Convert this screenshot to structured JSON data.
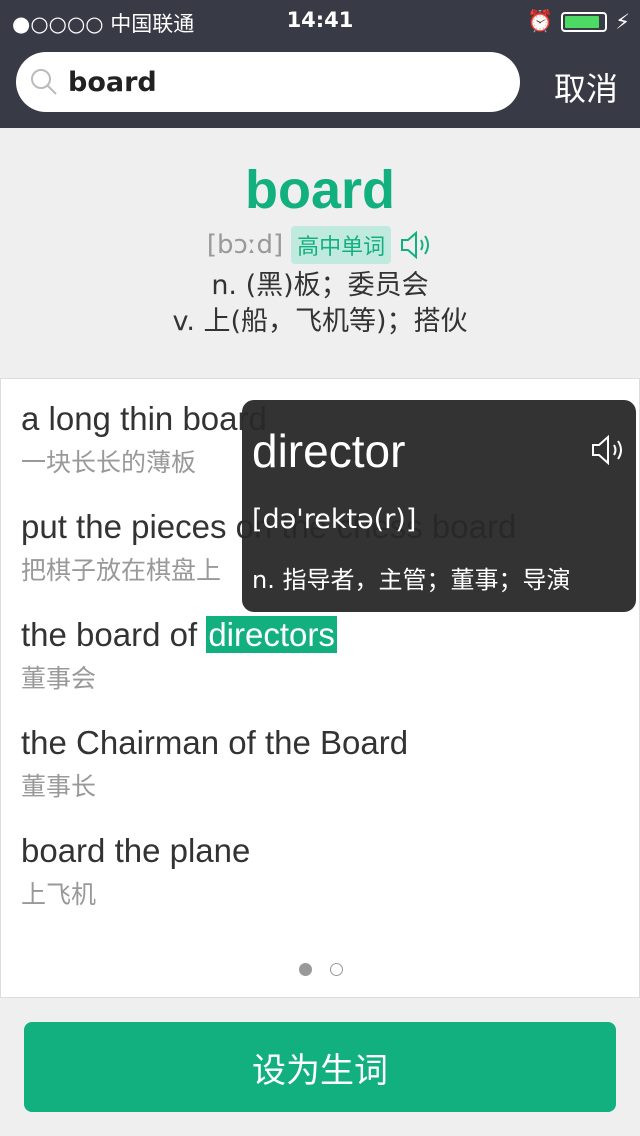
{
  "status": {
    "carrier": "●○○○○ 中国联通",
    "time": "14:41",
    "battery_level": 0.9
  },
  "search": {
    "value": "board",
    "cancel": "取消"
  },
  "entry": {
    "word": "board",
    "phonetic": "[bɔːd]",
    "tag": "高中单词",
    "definitions": [
      "n. (黑)板；委员会",
      "v. 上(船，飞机等)；搭伙"
    ]
  },
  "examples": [
    {
      "en": "a long thin board",
      "cn": "一块长长的薄板"
    },
    {
      "en": "put the pieces on the chess board",
      "cn": "把棋子放在棋盘上"
    },
    {
      "en_before": "the board of ",
      "en_highlight": "directors",
      "cn": "董事会"
    },
    {
      "en": "the Chairman of the Board",
      "cn": "董事长"
    },
    {
      "en": "board the plane",
      "cn": "上飞机"
    }
  ],
  "pagination": {
    "pages": 2,
    "current": 1
  },
  "popup": {
    "word": "director",
    "phonetic": "[də'rektə(r)]",
    "definition": "n. 指导者，主管；董事；导演"
  },
  "action": {
    "label": "设为生词"
  },
  "colors": {
    "accent": "#13b07f",
    "header": "#383a46"
  }
}
